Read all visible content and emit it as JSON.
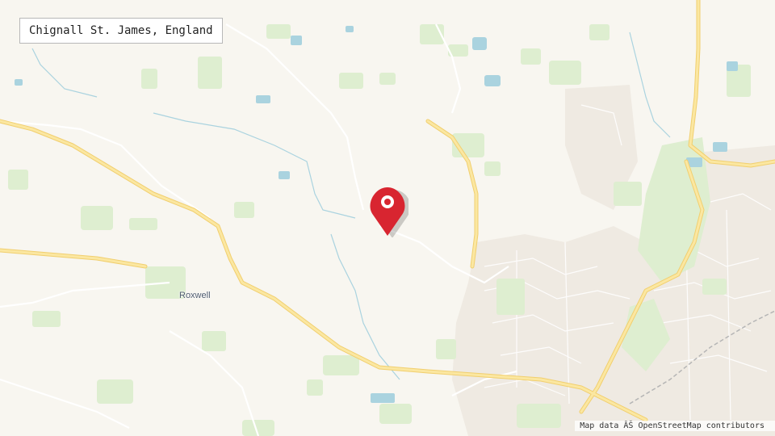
{
  "location": {
    "name": "Chignall St. James, England"
  },
  "map": {
    "town_labels": [
      "Roxwell"
    ],
    "attribution": "Map data ÂŠ OpenStreetMap contributors",
    "colors": {
      "background": "#f8f6f0",
      "woodland": "#deeed0",
      "water": "#aad3df",
      "road": "#fbe7a1",
      "road_outline": "#f1cf6f",
      "urban": "#efeae2",
      "street": "#ffffff",
      "marker": "#d82530"
    },
    "marker_icon": "map-pin-icon"
  }
}
